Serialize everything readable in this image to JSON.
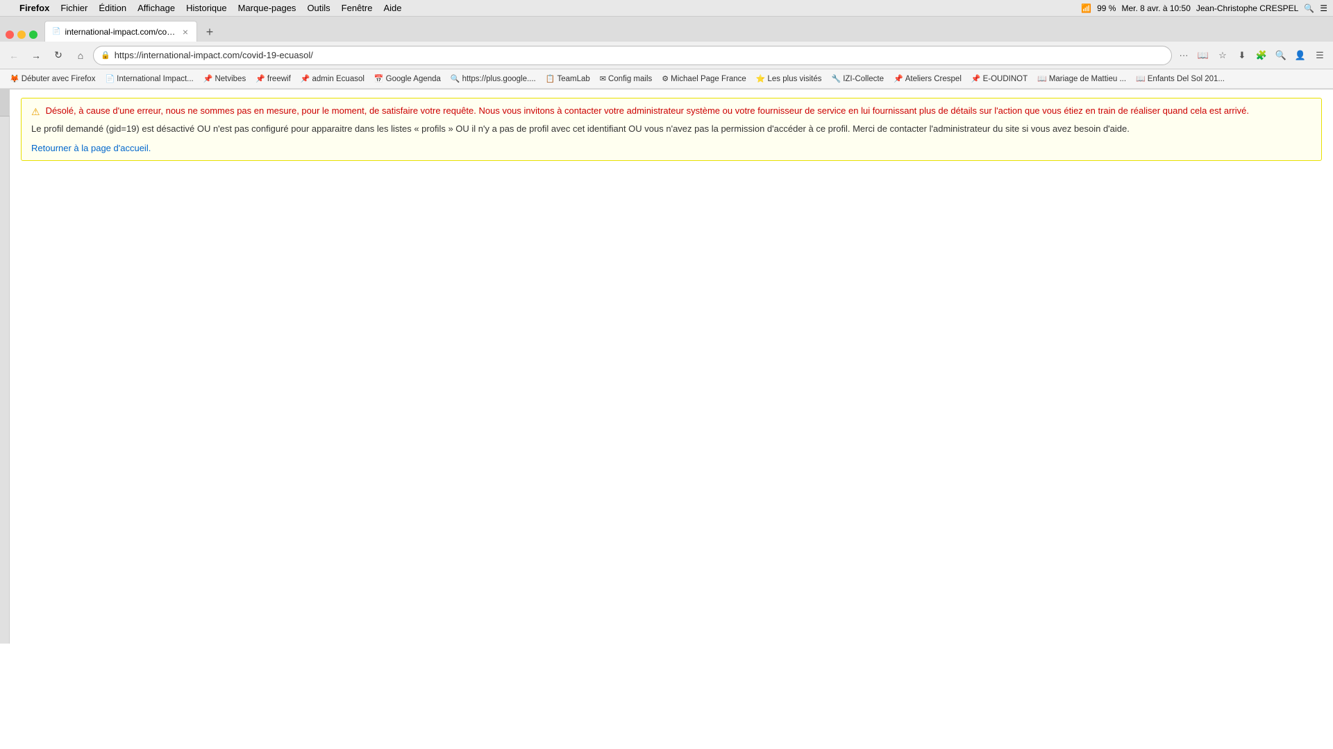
{
  "macos": {
    "apple_symbol": "",
    "menu_items": [
      "Firefox",
      "Fichier",
      "Édition",
      "Affichage",
      "Historique",
      "Marque-pages",
      "Outils",
      "Fenêtre",
      "Aide"
    ],
    "right_items": {
      "battery_icon": "🔋",
      "battery_percent": "99 %",
      "date_time": "Mer. 8 avr. à 10:50",
      "user": "Jean-Christophe CRESPEL"
    }
  },
  "browser": {
    "tab": {
      "title": "international-impact.com/covi...",
      "favicon": "📄"
    },
    "url": "https://international-impact.com/covid-19-ecuasol/",
    "nav": {
      "back": "←",
      "forward": "→",
      "reload": "↻",
      "home": "⌂",
      "more": "···",
      "reader": "📖",
      "bookmark_star": "☆",
      "download": "⬇",
      "extensions": "🧩"
    },
    "bookmarks": [
      {
        "label": "Débuter avec Firefox",
        "icon": "🦊"
      },
      {
        "label": "International Impact...",
        "icon": "📄"
      },
      {
        "label": "Netvibes",
        "icon": "📌"
      },
      {
        "label": "freewif",
        "icon": "📌"
      },
      {
        "label": "admin Ecuasol",
        "icon": "📌"
      },
      {
        "label": "Google Agenda",
        "icon": "📅"
      },
      {
        "label": "https://plus.google....",
        "icon": "🔍"
      },
      {
        "label": "TeamLab",
        "icon": "📋"
      },
      {
        "label": "Config mails",
        "icon": "✉"
      },
      {
        "label": "Michael Page France",
        "icon": "⚙"
      },
      {
        "label": "Les plus visités",
        "icon": "⭐"
      },
      {
        "label": "IZI-Collecte",
        "icon": "🔧"
      },
      {
        "label": "Ateliers Crespel",
        "icon": "📌"
      },
      {
        "label": "E-OUDINOT",
        "icon": "📌"
      },
      {
        "label": "Mariage de Mattieu ...",
        "icon": "📖"
      },
      {
        "label": "Enfants Del Sol 201...",
        "icon": "📖"
      }
    ]
  },
  "page": {
    "error_icon": "⚠",
    "error_message": "Désolé, à cause d'une erreur, nous ne sommes pas en mesure, pour le moment, de satisfaire votre requête. Nous vous invitons à contacter votre administrateur système ou votre fournisseur de service en lui fournissant plus de détails sur l'action que vous étiez en train de réaliser quand cela est arrivé.",
    "error_detail": "Le profil demandé (gid=19) est désactivé OU n'est pas configuré pour apparaitre dans les listes « profils » OU il n'y a pas de profil avec cet identifiant OU vous n'avez pas la permission d'accéder à ce profil. Merci de contacter l'administrateur du site si vous avez besoin d'aide.",
    "return_link": "Retourner à la page d'accueil."
  }
}
